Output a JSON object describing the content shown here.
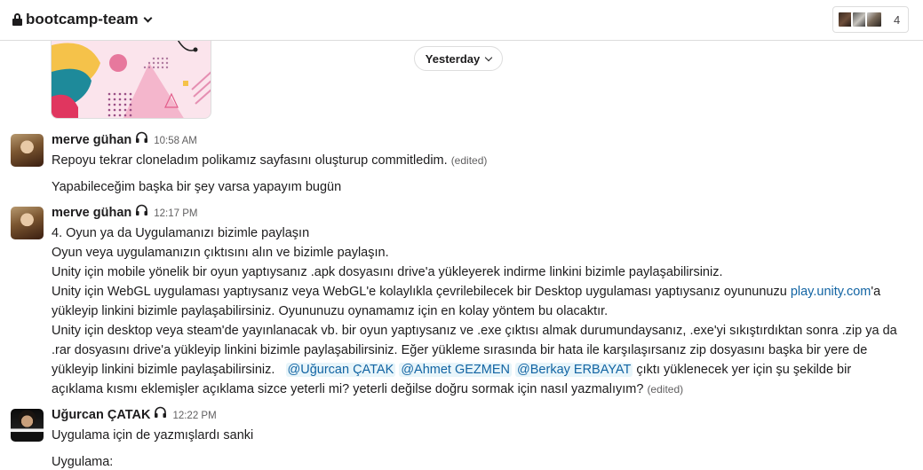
{
  "header": {
    "channel_name": "bootcamp-team",
    "member_count": "4"
  },
  "date_divider": {
    "label": "Yesterday"
  },
  "messages": [
    {
      "sender": "merve gühan",
      "time": "10:58 AM",
      "lines": [
        "Repoyu tekrar cloneladım polikamız sayfasını oluşturup commitledim."
      ],
      "edited": "(edited)",
      "followup": "Yapabileceğim başka bir şey varsa yapayım bugün"
    },
    {
      "sender": "merve gühan",
      "time": "12:17 PM",
      "lines": [
        "4. Oyun ya da Uygulamanızı bizimle paylaşın",
        "Oyun veya uygulamanızın çıktısını alın ve bizimle paylaşın.",
        "Unity için mobile yönelik bir oyun yaptıysanız .apk dosyasını drive'a yükleyerek indirme linkini bizimle paylaşabilirsiniz.",
        "Unity için WebGL uygulaması yaptıysanız veya WebGL'e kolaylıkla çevrilebilecek bir Desktop uygulaması yaptıysanız oyununuzu ",
        "'a",
        "yükleyip linkini bizimle paylaşabilirsiniz. Oyununuzu oynamamız için en kolay yöntem bu olacaktır.",
        "Unity için desktop veya steam'de yayınlanacak vb. bir oyun yaptıysanız ve .exe çıktısı almak durumundaysanız, .exe'yi sıkıştırdıktan sonra .zip ya da",
        ".rar dosyasını drive'a yükleyip linkini bizimle paylaşabilirsiniz. Eğer yükleme sırasında bir hata ile karşılaşırsanız zip dosyasını başka bir yere de",
        "yükleyip linkini bizimle paylaşabilirsiniz.",
        "çıktı yüklenecek yer için şu şekilde bir",
        "açıklama kısmı eklemişler açıklama sizce yeterli mi? yeterli değilse doğru sormak için nasıl yazmalıyım?"
      ],
      "link_text": "play.unity.com",
      "mentions": [
        "@Uğurcan ÇATAK",
        "@Ahmet GEZMEN",
        "@Berkay ERBAYAT"
      ],
      "edited": "(edited)"
    },
    {
      "sender": "Uğurcan ÇATAK",
      "time": "12:22 PM",
      "lines": [
        "Uygulama için de yazmışlardı sanki"
      ],
      "followup": "Uygulama:"
    }
  ],
  "colors": {
    "link": "#1264a3",
    "mention_bg": "#e8f5fa",
    "timestamp": "#616061",
    "border": "#dddddd"
  },
  "icons": [
    "lock-icon",
    "chevron-down-icon",
    "headphones-icon"
  ]
}
